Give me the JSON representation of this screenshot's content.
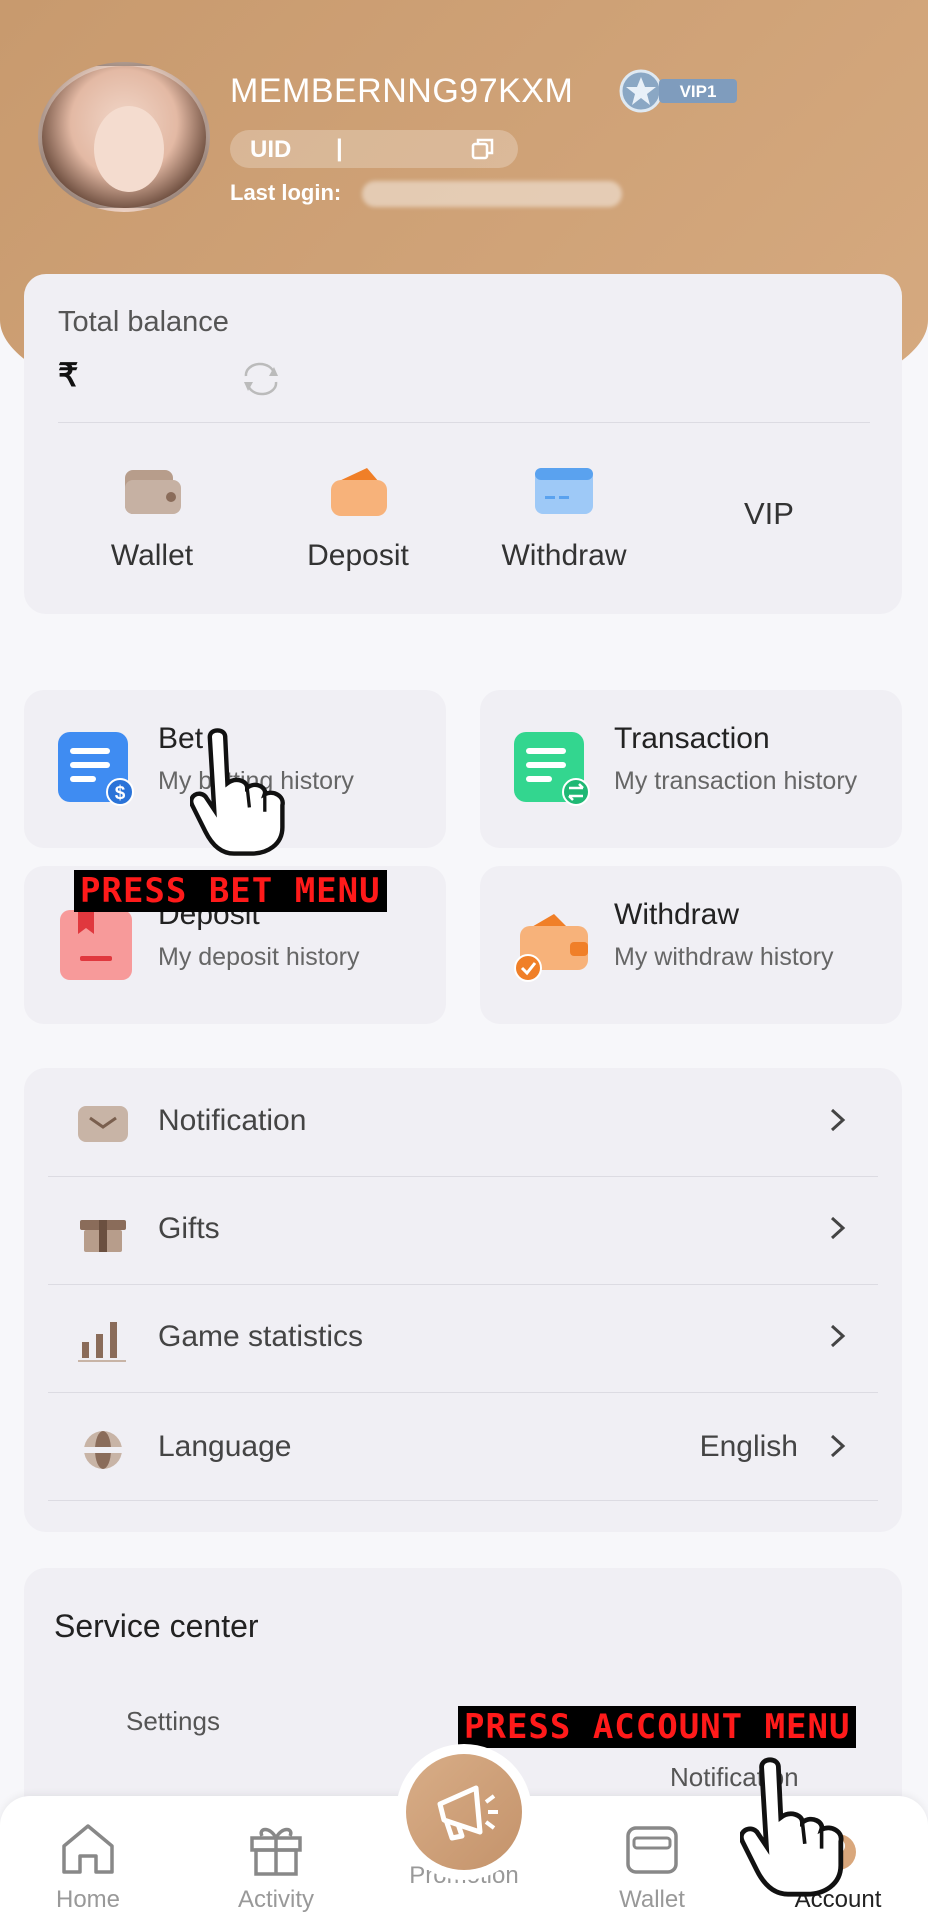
{
  "profile": {
    "username": "MEMBERNNG97KXM",
    "vip_badge": "VIP1",
    "uid_label": "UID",
    "uid_separator": "|",
    "last_login_label": "Last login:"
  },
  "balance": {
    "title": "Total balance",
    "currency": "₹",
    "actions": [
      {
        "label": "Wallet",
        "icon": "wallet-icon"
      },
      {
        "label": "Deposit",
        "icon": "deposit-icon"
      },
      {
        "label": "Withdraw",
        "icon": "withdraw-icon"
      },
      {
        "label": "VIP",
        "icon": ""
      }
    ]
  },
  "history": [
    {
      "title": "Bet",
      "subtitle": "My betting history",
      "icon": "bet-history-icon",
      "color": "#3f8cf2"
    },
    {
      "title": "Transaction",
      "subtitle": "My transaction history",
      "icon": "transaction-history-icon",
      "color": "#33d68f"
    },
    {
      "title": "Deposit",
      "subtitle": "My deposit history",
      "icon": "deposit-history-icon",
      "color": "#f26e6e"
    },
    {
      "title": "Withdraw",
      "subtitle": "My withdraw history",
      "icon": "withdraw-history-icon",
      "color": "#f5a25c"
    }
  ],
  "menu": [
    {
      "label": "Notification",
      "icon": "mail-icon",
      "value": ""
    },
    {
      "label": "Gifts",
      "icon": "gift-icon",
      "value": ""
    },
    {
      "label": "Game statistics",
      "icon": "bar-chart-icon",
      "value": ""
    },
    {
      "label": "Language",
      "icon": "globe-icon",
      "value": "English"
    }
  ],
  "service": {
    "title": "Service center",
    "items": [
      "Settings",
      "Notification"
    ]
  },
  "overlays": {
    "bet": "PRESS BET MENU",
    "account": "PRESS ACCOUNT MENU"
  },
  "tabs": [
    {
      "label": "Home",
      "icon": "home-icon"
    },
    {
      "label": "Activity",
      "icon": "gift-icon"
    },
    {
      "label": "Promotion",
      "icon": "megaphone-icon"
    },
    {
      "label": "Wallet",
      "icon": "wallet-icon"
    },
    {
      "label": "Account",
      "icon": "account-icon",
      "active": true
    }
  ],
  "colors": {
    "brand": "#c89a6e",
    "card": "#f0eff4",
    "overlay_text": "#ff1a1a"
  }
}
